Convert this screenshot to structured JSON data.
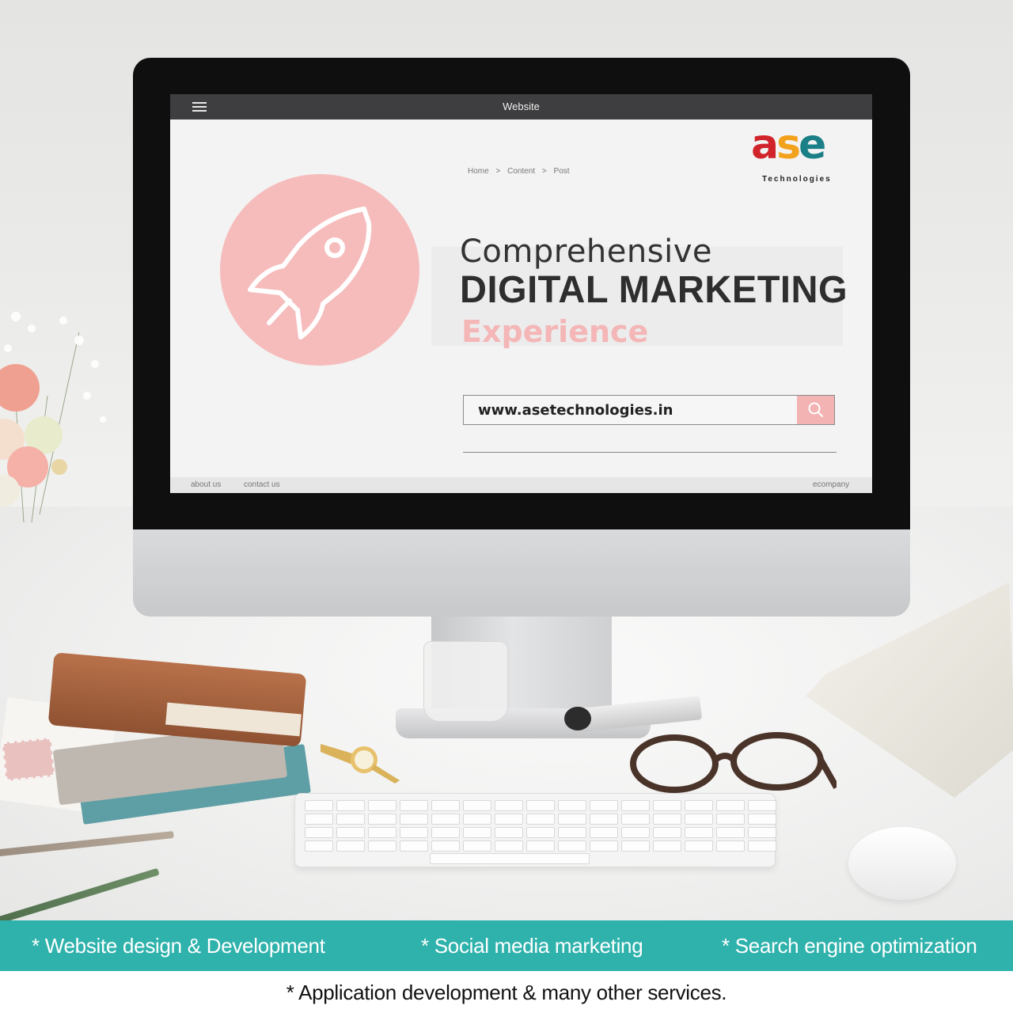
{
  "browser": {
    "title": "Website",
    "menu_icon": "hamburger-icon"
  },
  "breadcrumb": [
    "Home",
    ">",
    "Content",
    ">",
    "Post"
  ],
  "brand": {
    "logo_letters": [
      "a",
      "s",
      "e"
    ],
    "logo_subtitle": "Technologies",
    "colors": {
      "a": "#d1232a",
      "s": "#f3a21b",
      "e": "#1a7f86"
    }
  },
  "hero": {
    "icon": "rocket-icon",
    "line1": "Comprehensive",
    "line2": "DIGITAL MARKETING",
    "line3": "Experience",
    "accent_color": "#f4b6b6"
  },
  "search": {
    "value": "www.asetechnologies.in",
    "button_icon": "search-icon"
  },
  "screen_footer": {
    "about": "about us",
    "contact": "contact us",
    "company": "ecompany"
  },
  "services": [
    "* Website design & Development",
    "* Social media marketing",
    "* Search engine optimization"
  ],
  "services_extra": "* Application development & many other services.",
  "colors": {
    "band": "#2fb2ac",
    "screen_bar": "#3e3e40"
  }
}
